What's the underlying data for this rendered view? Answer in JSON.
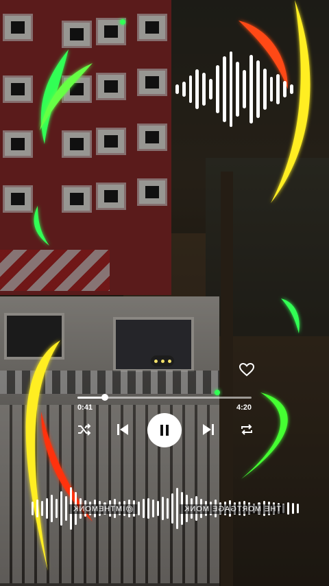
{
  "player": {
    "current_time": "0:41",
    "total_time": "4:20",
    "progress": 0.157,
    "liked": false,
    "controls": [
      "shuffle-icon",
      "previous-icon",
      "pause-icon",
      "next-icon",
      "repeat-icon"
    ]
  },
  "overlay": {
    "title_mirrored": "THE MORTGAGE MONK",
    "handle_mirrored": "@IMTHEMONK"
  },
  "colors": {
    "neon_green": "#33ff55",
    "neon_yellow": "#ffee22",
    "neon_red": "#ff3010",
    "waveform": "#ffffff"
  }
}
